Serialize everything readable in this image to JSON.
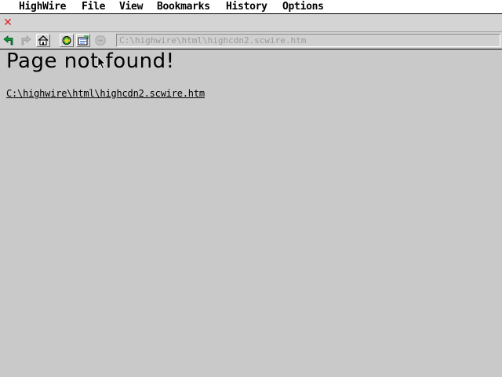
{
  "menubar": {
    "items": [
      "HighWire",
      "File",
      "View",
      "Bookmarks",
      "History",
      "Options"
    ]
  },
  "window": {
    "close_icon": "close-icon",
    "close_color": "#e02020"
  },
  "toolbar": {
    "buttons": [
      {
        "name": "back-button",
        "icon": "back-arrow-icon",
        "enabled": true
      },
      {
        "name": "forward-button",
        "icon": "forward-arrow-icon",
        "enabled": false
      },
      {
        "name": "home-button",
        "icon": "home-icon",
        "enabled": true
      },
      {
        "name": "reload-button",
        "icon": "reload-icon",
        "enabled": true
      },
      {
        "name": "open-button",
        "icon": "open-file-icon",
        "enabled": true
      },
      {
        "name": "stop-button",
        "icon": "stop-icon",
        "enabled": false
      }
    ],
    "url_value": "C:\\highwire\\html\\highcdn2.scwire.htm"
  },
  "content": {
    "heading": "Page not found!",
    "missing_url": "C:\\highwire\\html\\highcdn2.scwire.htm"
  },
  "colors": {
    "desktop": "#c9c9c9",
    "accent_green": "#0a9a3a",
    "accent_yellow": "#e8d020"
  }
}
